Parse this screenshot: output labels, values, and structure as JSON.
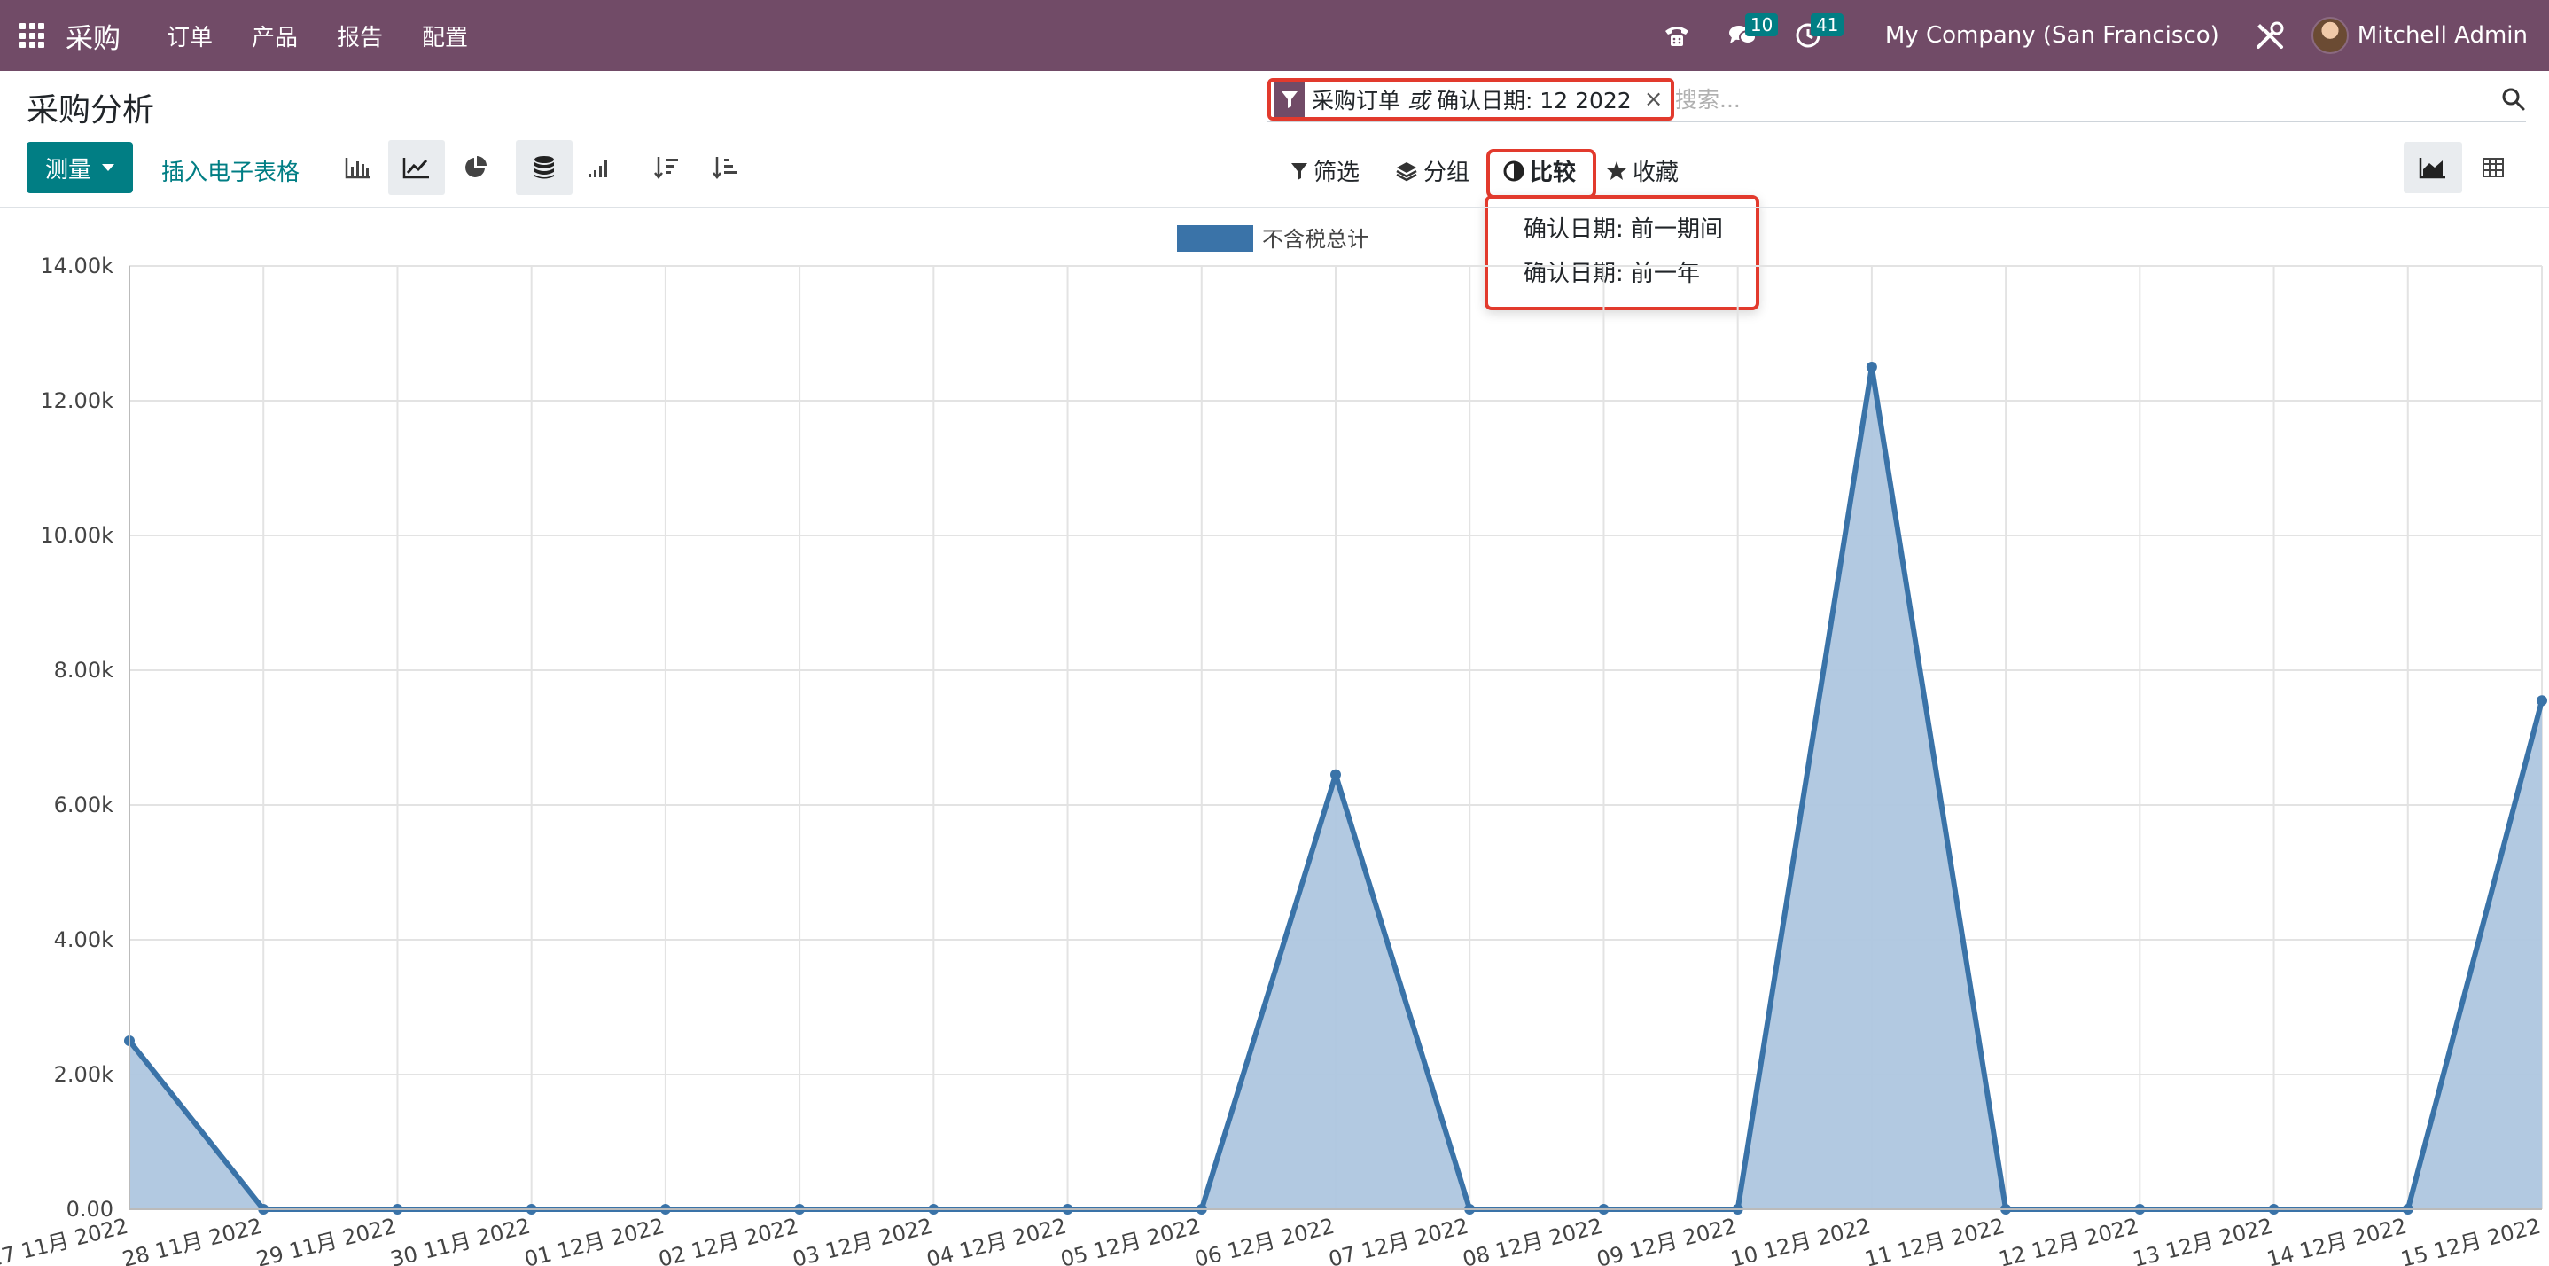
{
  "navbar": {
    "brand": "采购",
    "menu": [
      "订单",
      "产品",
      "报告",
      "配置"
    ],
    "messages_count": "10",
    "activities_count": "41",
    "company": "My Company (San Francisco)",
    "user": "Mitchell Admin"
  },
  "control_panel": {
    "title": "采购分析",
    "facet": {
      "part1": "采购订单",
      "connector": "或",
      "part2": "确认日期: 12 2022"
    },
    "search_placeholder": "搜索...",
    "measure_label": "测量",
    "insert_label": "插入电子表格",
    "filter_label": "筛选",
    "group_label": "分组",
    "compare_label": "比较",
    "favorites_label": "收藏",
    "compare_options": [
      "确认日期: 前一期间",
      "确认日期: 前一年"
    ]
  },
  "colors": {
    "navbar": "#714B67",
    "primary": "#017e84",
    "series_line": "#3a73a8",
    "series_fill": "#aec6df",
    "highlight": "#e23a2d"
  },
  "chart_data": {
    "type": "area",
    "categories": [
      "27 11月 2022",
      "28 11月 2022",
      "29 11月 2022",
      "30 11月 2022",
      "01 12月 2022",
      "02 12月 2022",
      "03 12月 2022",
      "04 12月 2022",
      "05 12月 2022",
      "06 12月 2022",
      "07 12月 2022",
      "08 12月 2022",
      "09 12月 2022",
      "10 12月 2022",
      "11 12月 2022",
      "12 12月 2022",
      "13 12月 2022",
      "14 12月 2022",
      "15 12月 2022"
    ],
    "series": [
      {
        "name": "不含税总计",
        "values": [
          2500,
          0,
          0,
          0,
          0,
          0,
          0,
          0,
          0,
          6450,
          0,
          0,
          0,
          12500,
          0,
          0,
          0,
          0,
          7550
        ]
      }
    ],
    "ylim": [
      0,
      14000
    ],
    "yticks": [
      "0.00",
      "2.00k",
      "4.00k",
      "6.00k",
      "8.00k",
      "10.00k",
      "12.00k",
      "14.00k"
    ],
    "grid": true,
    "legend": "top-center"
  }
}
